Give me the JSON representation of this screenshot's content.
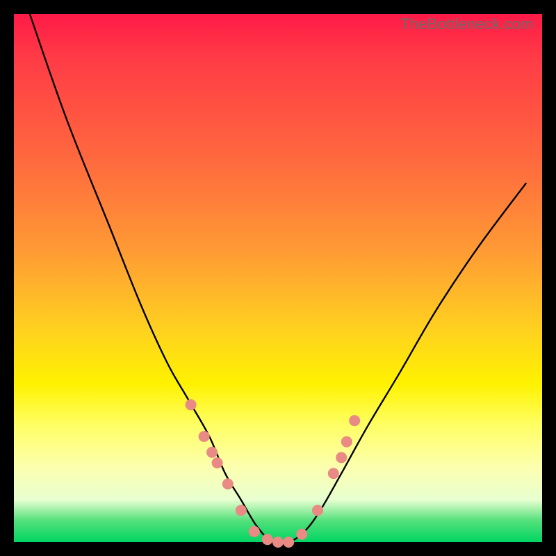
{
  "watermark": "TheBottleneck.com",
  "chart_data": {
    "type": "line",
    "title": "",
    "xlabel": "",
    "ylabel": "",
    "ylim": [
      0,
      100
    ],
    "series": [
      {
        "name": "bottleneck-curve",
        "x": [
          0.03,
          0.1,
          0.18,
          0.24,
          0.29,
          0.33,
          0.37,
          0.4,
          0.43,
          0.46,
          0.49,
          0.52,
          0.55,
          0.58,
          0.62,
          0.67,
          0.73,
          0.8,
          0.88,
          0.97
        ],
        "values": [
          100,
          80,
          60,
          45,
          34,
          27,
          20,
          13,
          8,
          3,
          0,
          0,
          2,
          6,
          13,
          22,
          32,
          44,
          56,
          68
        ]
      }
    ],
    "markers": {
      "name": "highlight-dots",
      "color": "#e98a84",
      "x": [
        0.335,
        0.36,
        0.375,
        0.385,
        0.405,
        0.43,
        0.455,
        0.48,
        0.5,
        0.52,
        0.545,
        0.575,
        0.605,
        0.62,
        0.63,
        0.645
      ],
      "values": [
        26,
        20,
        17,
        15,
        11,
        6,
        2,
        0.5,
        0,
        0,
        1.5,
        6,
        13,
        16,
        19,
        23
      ]
    }
  }
}
